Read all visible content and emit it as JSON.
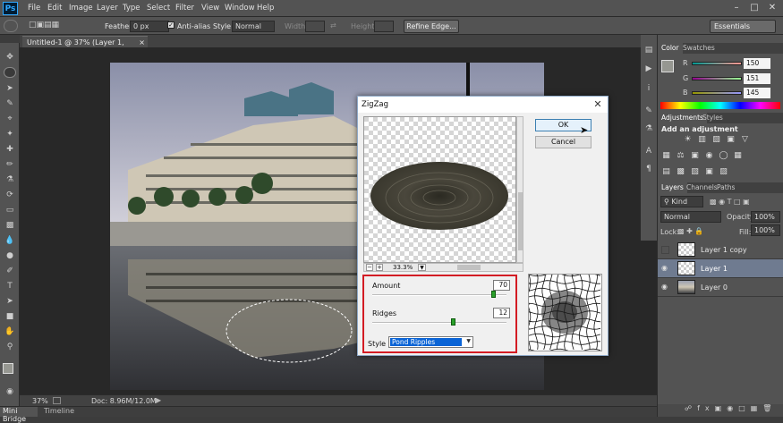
{
  "app": {
    "logo": "Ps"
  },
  "menu": [
    "File",
    "Edit",
    "Image",
    "Layer",
    "Type",
    "Select",
    "Filter",
    "View",
    "Window",
    "Help"
  ],
  "options": {
    "feather_label": "Feather:",
    "feather_value": "0 px",
    "antialias_label": "Anti-alias",
    "style_label": "Style:",
    "style_value": "Normal",
    "width_label": "Width:",
    "height_label": "Height:",
    "refine_button": "Refine Edge...",
    "workspace": "Essentials"
  },
  "document": {
    "tab_title": "Untitled-1 @ 37% (Layer 1, RGB/8) *",
    "zoom": "37%",
    "doc_info": "Doc: 8.96M/12.0M"
  },
  "bottom_tabs": [
    "Mini Bridge",
    "Timeline"
  ],
  "color_panel": {
    "tabs": [
      "Color",
      "Swatches"
    ],
    "r_label": "R",
    "g_label": "G",
    "b_label": "B",
    "r": "150",
    "g": "151",
    "b": "145"
  },
  "adjustments_panel": {
    "tabs": [
      "Adjustments",
      "Styles"
    ],
    "hint": "Add an adjustment"
  },
  "layers_panel": {
    "tabs": [
      "Layers",
      "Channels",
      "Paths"
    ],
    "kind": "Kind",
    "blend": "Normal",
    "opacity_label": "Opacity:",
    "opacity": "100%",
    "lock_label": "Lock:",
    "fill_label": "Fill:",
    "fill": "100%",
    "layers": [
      {
        "name": "Layer 1 copy"
      },
      {
        "name": "Layer 1"
      },
      {
        "name": "Layer 0"
      }
    ]
  },
  "dialog": {
    "title": "ZigZag",
    "ok": "OK",
    "cancel": "Cancel",
    "preview_zoom": "33.3%",
    "amount_label": "Amount",
    "amount": "70",
    "amount_fraction": 0.9,
    "ridges_label": "Ridges",
    "ridges": "12",
    "ridges_fraction": 0.6,
    "style_label": "Style",
    "style_value": "Pond Ripples"
  },
  "colors": {
    "accent": "#0a64d6",
    "highlight_box": "#d31c24",
    "slider_thumb": "#2aa12a"
  }
}
